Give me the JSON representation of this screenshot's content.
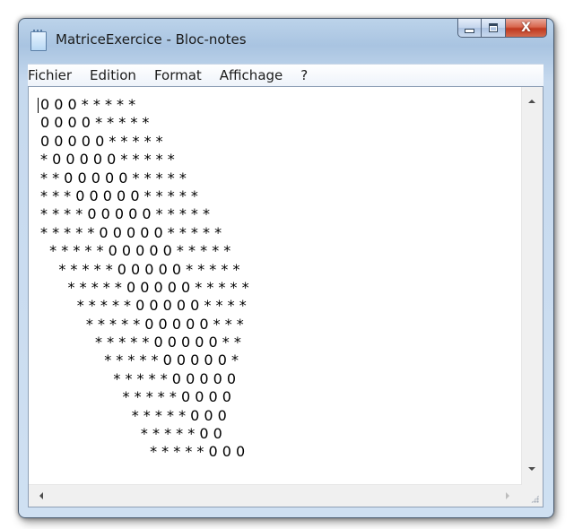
{
  "window": {
    "title": "MatriceExercice - Bloc-notes",
    "app_icon": "notepad-icon"
  },
  "caption_buttons": {
    "minimize_icon": "minimize-icon",
    "maximize_icon": "maximize-icon",
    "close_icon": "close-icon",
    "close_glyph": "X"
  },
  "menu": {
    "items": [
      {
        "label": "Fichier"
      },
      {
        "label": "Edition"
      },
      {
        "label": "Format"
      },
      {
        "label": "Affichage"
      },
      {
        "label": "?"
      }
    ]
  },
  "document": {
    "lines": [
      "0 0 0 * * * * *",
      "0 0 0 0 * * * * *",
      "0 0 0 0 0 * * * * *",
      "* 0 0 0 0 0 * * * * *",
      "* * 0 0 0 0 0 * * * * *",
      "* * * 0 0 0 0 0 * * * * *",
      "* * * * 0 0 0 0 0 * * * * *",
      "* * * * * 0 0 0 0 0 * * * * *",
      "  * * * * * 0 0 0 0 0 * * * * *",
      "    * * * * * 0 0 0 0 0 * * * * *",
      "      * * * * * 0 0 0 0 0 * * * * *",
      "        * * * * * 0 0 0 0 0 * * * *",
      "          * * * * * 0 0 0 0 0 * * *",
      "            * * * * * 0 0 0 0 0 * *",
      "              * * * * * 0 0 0 0 0 *",
      "                * * * * * 0 0 0 0 0",
      "                  * * * * * 0 0 0 0",
      "                    * * * * * 0 0 0",
      "                      * * * * * 0 0",
      "                        * * * * * 0 0 0"
    ]
  },
  "scrollbars": {
    "up_icon": "scroll-up-arrow-icon",
    "down_icon": "scroll-down-arrow-icon",
    "left_icon": "scroll-left-arrow-icon",
    "right_icon": "scroll-right-arrow-icon",
    "grip_icon": "size-grip-icon"
  }
}
